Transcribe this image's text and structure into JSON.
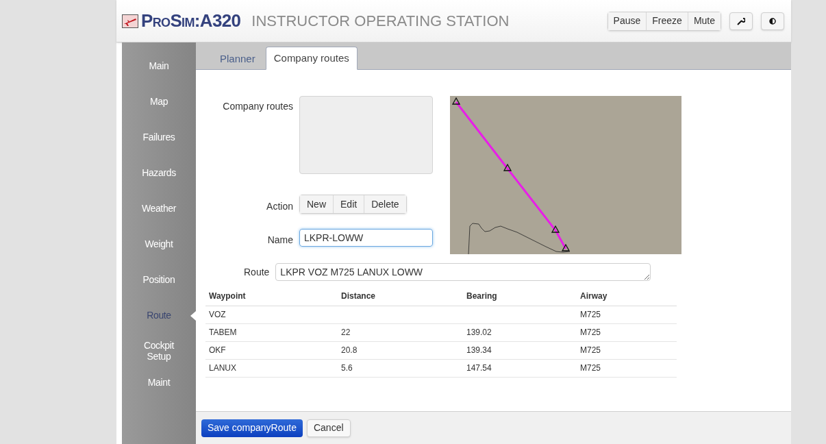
{
  "header": {
    "logo": "ProSim:A320",
    "title": "INSTRUCTOR OPERATING STATION",
    "buttons": [
      "Pause",
      "Freeze",
      "Mute"
    ]
  },
  "sidebar": {
    "items": [
      {
        "label": "Main",
        "selected": false
      },
      {
        "label": "Map",
        "selected": false
      },
      {
        "label": "Failures",
        "selected": false
      },
      {
        "label": "Hazards",
        "selected": false
      },
      {
        "label": "Weather",
        "selected": false
      },
      {
        "label": "Weight",
        "selected": false
      },
      {
        "label": "Position",
        "selected": false
      },
      {
        "label": "Route",
        "selected": true
      },
      {
        "label": "Cockpit Setup",
        "selected": false
      },
      {
        "label": "Maint",
        "selected": false
      }
    ]
  },
  "tabs": [
    {
      "label": "Planner",
      "selected": false
    },
    {
      "label": "Company routes",
      "selected": true
    }
  ],
  "form": {
    "company_routes_label": "Company routes",
    "action_label": "Action",
    "action_buttons": [
      "New",
      "Edit",
      "Delete"
    ],
    "name_label": "Name",
    "name_value": "LKPR-LOWW",
    "route_label": "Route",
    "route_value": "LKPR VOZ M725 LANUX LOWW"
  },
  "table": {
    "columns": [
      "Waypoint",
      "Distance",
      "Bearing",
      "Airway"
    ],
    "rows": [
      [
        "VOZ",
        "",
        "",
        "M725"
      ],
      [
        "TABEM",
        "22",
        "139.02",
        "M725"
      ],
      [
        "OKF",
        "20.8",
        "139.34",
        "M725"
      ],
      [
        "LANUX",
        "5.6",
        "147.54",
        "M725"
      ]
    ]
  },
  "footer": {
    "save_button": "Save companyRoute",
    "cancel_button": "Cancel"
  }
}
